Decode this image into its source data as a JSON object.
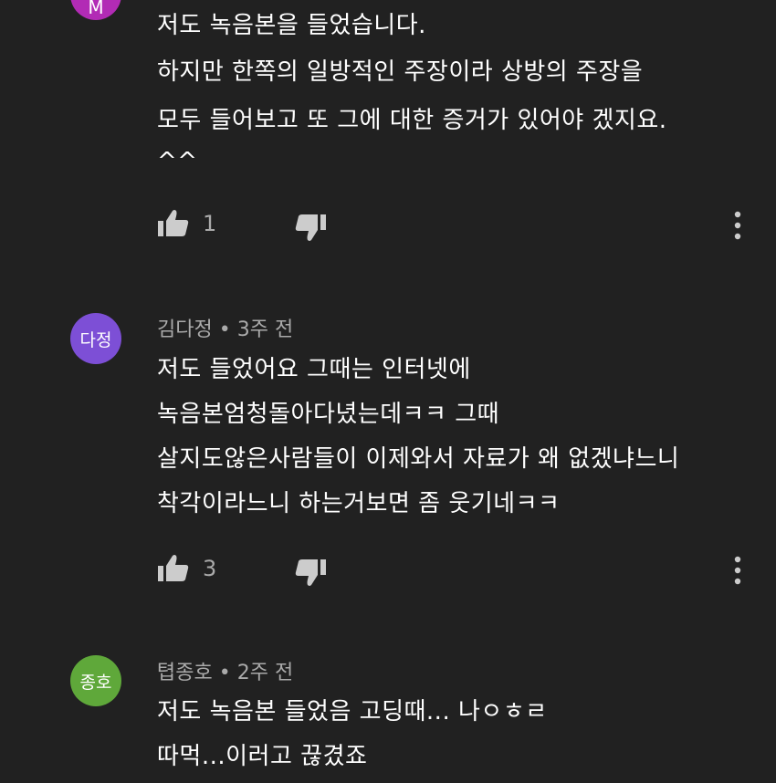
{
  "comments": [
    {
      "avatar_text": "M",
      "avatar_color": "#b22bb5",
      "author": "",
      "time": "",
      "lines": [
        "저도 녹음본을 들었습니다.",
        "하지만 한쪽의 일방적인 주장이라 상방의 주장을",
        "모두 들어보고 또 그에 대한 증거가 있어야 겠지요.",
        "^^"
      ],
      "likes": "1"
    },
    {
      "avatar_text": "다정",
      "avatar_color": "#7d4fd6",
      "author": "김다정",
      "separator": "•",
      "time": "3주 전",
      "lines": [
        "저도 들었어요 그때는 인터넷에",
        "녹음본엄청돌아다녔는데ㅋㅋ 그때",
        "살지도않은사람들이 이제와서 자료가 왜 없겠냐느니",
        "착각이라느니 하는거보면 좀 웃기네ㅋㅋ"
      ],
      "likes": "3"
    },
    {
      "avatar_text": "종호",
      "avatar_color": "#5fa83a",
      "author": "텹종호",
      "separator": "•",
      "time": "2주 전",
      "lines": [
        "저도 녹음본 들었음 고딩때... 나ㅇㅎㄹ",
        "따먹...이러고 끊겼죠"
      ]
    }
  ],
  "icons": {
    "like": "thumbs-up-icon",
    "dislike": "thumbs-down-icon",
    "more": "more-vert-icon"
  },
  "colors": {
    "background": "#212121",
    "text": "#ffffff",
    "meta_text": "#aaaaaa",
    "icon": "#cccccc"
  }
}
